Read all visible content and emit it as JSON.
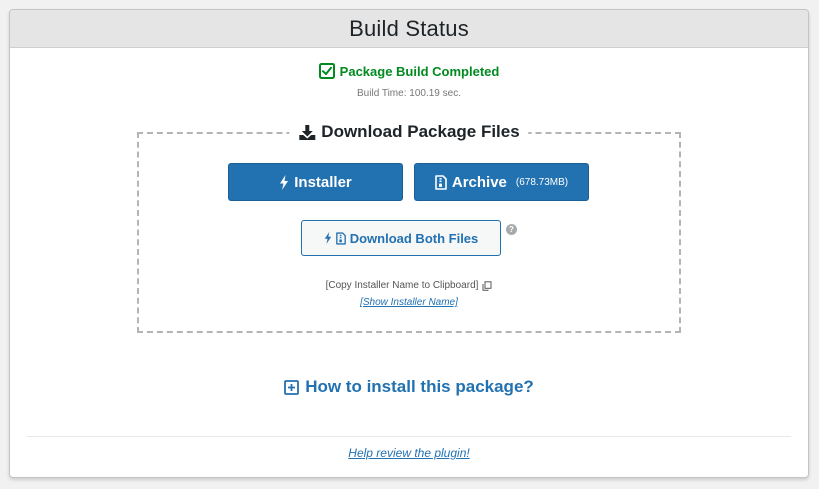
{
  "header": {
    "title": "Build Status"
  },
  "status": {
    "completed_text": "Package Build Completed",
    "build_time_label": "Build Time:",
    "build_time_value": "100.19 sec."
  },
  "download": {
    "legend": "Download Package Files",
    "installer_label": "Installer",
    "archive_label": "Archive",
    "archive_size": "(678.73MB)",
    "both_label": "Download Both Files",
    "help_glyph": "?",
    "copy_installer_label": "[Copy Installer Name to Clipboard]",
    "show_installer_label": "[Show Installer Name]"
  },
  "howto": {
    "label": "How to install this package?"
  },
  "footer": {
    "review_label": "Help review the plugin!"
  },
  "colors": {
    "success": "#008a20",
    "accent": "#2271b1",
    "header_bg": "#e5e5e5"
  },
  "icons": {
    "status": "checkbox-check-icon",
    "legend": "download-icon",
    "installer": "bolt-icon",
    "archive": "file-archive-icon",
    "both": [
      "bolt-icon",
      "file-archive-icon"
    ],
    "copy": "copy-icon",
    "howto": "plus-square-icon"
  }
}
